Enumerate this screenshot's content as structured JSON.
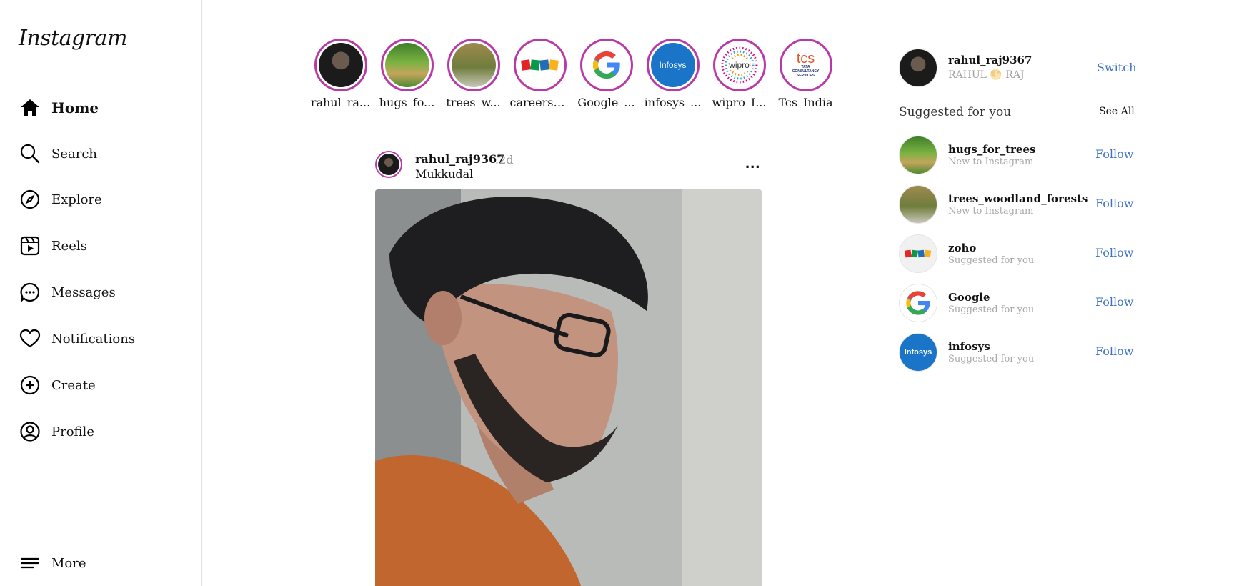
{
  "sidebar": {
    "logo": "Instagram",
    "items": [
      {
        "label": "Home",
        "icon": "home-icon"
      },
      {
        "label": "Search",
        "icon": "search-icon"
      },
      {
        "label": "Explore",
        "icon": "compass-icon"
      },
      {
        "label": "Reels",
        "icon": "reels-icon"
      },
      {
        "label": "Messages",
        "icon": "messages-icon"
      },
      {
        "label": "Notifications",
        "icon": "heart-icon"
      },
      {
        "label": "Create",
        "icon": "plus-circle-icon"
      },
      {
        "label": "Profile",
        "icon": "profile-icon"
      }
    ],
    "more": {
      "label": "More",
      "icon": "menu-icon"
    }
  },
  "stories": [
    {
      "label": "rahul_ra..."
    },
    {
      "label": "hugs_fo..."
    },
    {
      "label": "trees_w..."
    },
    {
      "label": "careers_..."
    },
    {
      "label": "Google_..."
    },
    {
      "label": "infosys_..."
    },
    {
      "label": "wipro_I..."
    },
    {
      "label": "Tcs_India"
    }
  ],
  "logos": {
    "zoho": "ZOHO",
    "infosys": "Infosys",
    "wipro": "wipro",
    "tcs": "tcs",
    "tcs_sub": "TATA CONSULTANCY SERVICES"
  },
  "post": {
    "username": "rahul_raj9367",
    "time": ".2d",
    "location": "Mukkudal",
    "more": "..."
  },
  "right": {
    "username": "rahul_raj9367",
    "name": "RAHUL 🌕 RAJ",
    "switch": "Switch",
    "suggested_title": "Suggested for you",
    "see_all": "See All",
    "suggestions": [
      {
        "name": "hugs_for_trees",
        "sub": "New to Instagram",
        "action": "Follow"
      },
      {
        "name": "trees_woodland_forests",
        "sub": "New to Instagram",
        "action": "Follow"
      },
      {
        "name": "zoho",
        "sub": "Suggested for you",
        "action": "Follow"
      },
      {
        "name": "Google",
        "sub": "Suggested for you",
        "action": "Follow"
      },
      {
        "name": "infosys",
        "sub": "Suggested for you",
        "action": "Follow"
      }
    ]
  },
  "colors": {
    "story_ring": "#b83aa7",
    "link_blue": "#3d72c4",
    "infosys_blue": "#1a75c8"
  }
}
